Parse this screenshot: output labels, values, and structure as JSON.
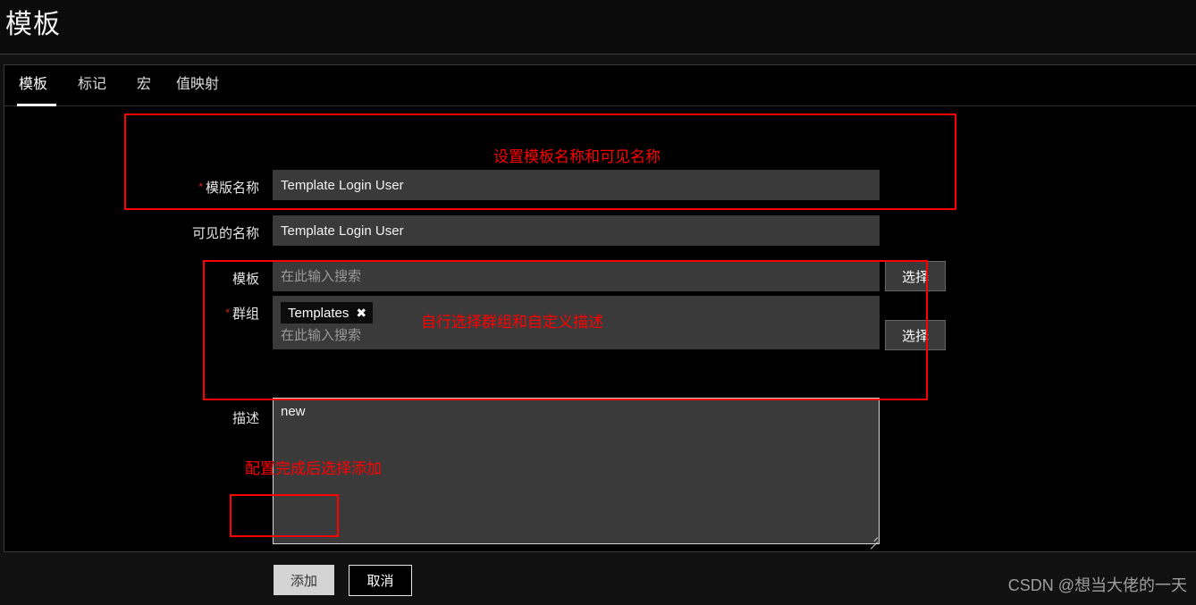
{
  "header": {
    "title": "模板"
  },
  "tabs": [
    {
      "label": "模板",
      "active": true
    },
    {
      "label": "标记",
      "active": false
    },
    {
      "label": "宏",
      "active": false
    },
    {
      "label": "值映射",
      "active": false
    }
  ],
  "form": {
    "template_name": {
      "label": "模版名称",
      "required": true,
      "value": "Template Login User"
    },
    "visible_name": {
      "label": "可见的名称",
      "required": false,
      "value": "Template Login User"
    },
    "templates": {
      "label": "模板",
      "required": false,
      "value": "",
      "placeholder": "在此输入搜索",
      "select_button": "选择"
    },
    "groups": {
      "label": "群组",
      "required": true,
      "chips": [
        "Templates"
      ],
      "chip_remove_icon": "✖",
      "placeholder": "在此输入搜索",
      "select_button": "选择"
    },
    "description": {
      "label": "描述",
      "required": false,
      "value": "new"
    }
  },
  "footer": {
    "add_label": "添加",
    "cancel_label": "取消"
  },
  "annotations": [
    {
      "text": "设置模板名称和可见名称"
    },
    {
      "text": "自行选择群组和自定义描述"
    },
    {
      "text": "配置完成后选择添加"
    }
  ],
  "watermark": {
    "text": "CSDN @想当大佬的一天"
  },
  "colors": {
    "accent_red": "#ff0000",
    "required_red": "#e2231a",
    "page_bg": "#111111",
    "panel_bg": "#000000",
    "input_bg": "#3a3a3a"
  }
}
